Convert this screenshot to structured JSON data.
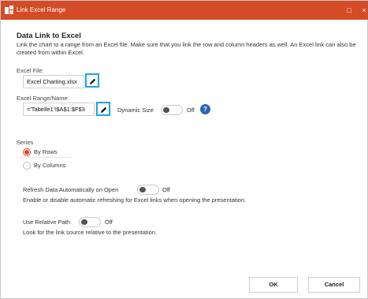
{
  "window": {
    "title": "Link Excel Range",
    "maximize_icon": "□",
    "close_icon": "×"
  },
  "section": {
    "heading": "Data Link to Excel",
    "description": "Link the chart to a range from an Excel file. Make sure that you link the row and column headers as well. An Excel link can also be created from within Excel."
  },
  "excel_file": {
    "label": "Excel File:",
    "value": "Excel Charting.xlsx"
  },
  "excel_range": {
    "label": "Excel Range/Name:",
    "value": "='Tabelle1'!$A$1:$F$3",
    "dynamic_size_label": "Dynamic Size",
    "dynamic_size_state": "Off",
    "help": "?"
  },
  "series": {
    "label": "Series",
    "options": [
      {
        "label": "By Rows",
        "checked": true
      },
      {
        "label": "By Columns",
        "checked": false
      }
    ]
  },
  "refresh": {
    "label": "Refresh Data Automatically on Open",
    "state": "Off",
    "description": "Enable or disable automatic refreshing for Excel links when opening the presentation."
  },
  "relative_path": {
    "label": "Use Relative Path",
    "state": "Off",
    "description": "Look for the link source relative to the presentation."
  },
  "buttons": {
    "ok": "OK",
    "cancel": "Cancel"
  },
  "colors": {
    "titlebar": "#d44b27",
    "accent": "#1ea5dd",
    "help": "#2a63b8"
  }
}
